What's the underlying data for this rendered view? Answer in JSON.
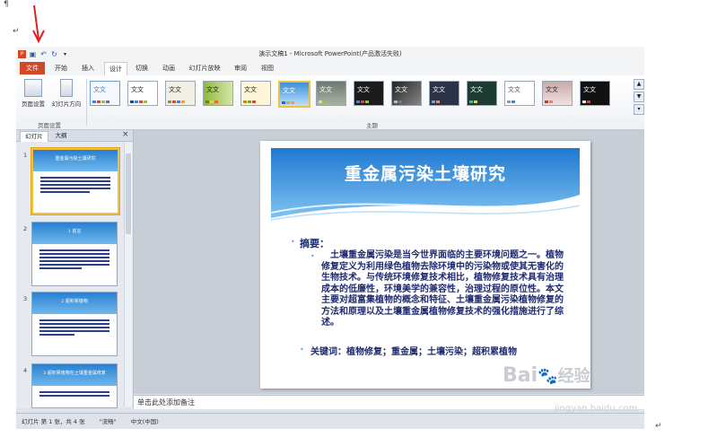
{
  "window": {
    "title": "演示文稿1 - Microsoft PowerPoint(产品激活失败)"
  },
  "qat": {
    "app_icon": "powerpoint-icon",
    "save_icon": "save-icon",
    "undo_icon": "undo-icon",
    "redo_icon": "redo-icon",
    "customize_icon": "chevron-down-icon"
  },
  "tabs": [
    {
      "label": "文件"
    },
    {
      "label": "开始"
    },
    {
      "label": "插入"
    },
    {
      "label": "设计"
    },
    {
      "label": "切换"
    },
    {
      "label": "动画"
    },
    {
      "label": "幻灯片放映"
    },
    {
      "label": "审阅"
    },
    {
      "label": "视图"
    }
  ],
  "ribbon": {
    "page_setup_label": "页面设置",
    "orientation_label": "幻灯片方向",
    "group_page_setup": "页面设置",
    "group_themes": "主题",
    "theme_sample_text": "文文"
  },
  "left_pane": {
    "tab_slides": "幻灯片",
    "tab_outline": "大纲",
    "close_icon": "close-icon",
    "slides": [
      {
        "num": "1",
        "title": "重金属污染土壤研究"
      },
      {
        "num": "2",
        "title": "1 前言"
      },
      {
        "num": "3",
        "title": "2 超积累植物"
      },
      {
        "num": "4",
        "title": "3 超积累植物在土壤重金属修复"
      }
    ]
  },
  "slide": {
    "title": "重金属污染土壤研究",
    "abstract_heading": "摘要：",
    "abstract_body": "土壤重金属污染是当今世界面临的主要环境问题之一。植物修复定义为利用绿色植物去除环境中的污染物或使其无害化的生物技术。与传统环境修复技术相比，植物修复技术具有治理成本的低廉性，环境美学的兼容性，治理过程的原位性。本文主要对超富集植物的概念和特征、土壤重金属污染植物修复的方法和原理以及土壤重金属植物修复技术的强化措施进行了综述。",
    "keywords": "关键词：植物修复；重金属；土壤污染；超积累植物"
  },
  "notes": {
    "placeholder": "单击此处添加备注"
  },
  "status": {
    "slide_info": "幻灯片 第 1 张，共 4 张",
    "theme_name": "\"流畅\"",
    "language": "中文(中国)"
  },
  "watermark": {
    "brand": "Bai",
    "brand2": "经验",
    "url": "jingyan.baidu.com"
  },
  "colors": {
    "file_tab": "#d24726",
    "accent_blue": "#2a7fd0",
    "slide_text": "#1f2b6e",
    "selection": "#f0c040"
  }
}
